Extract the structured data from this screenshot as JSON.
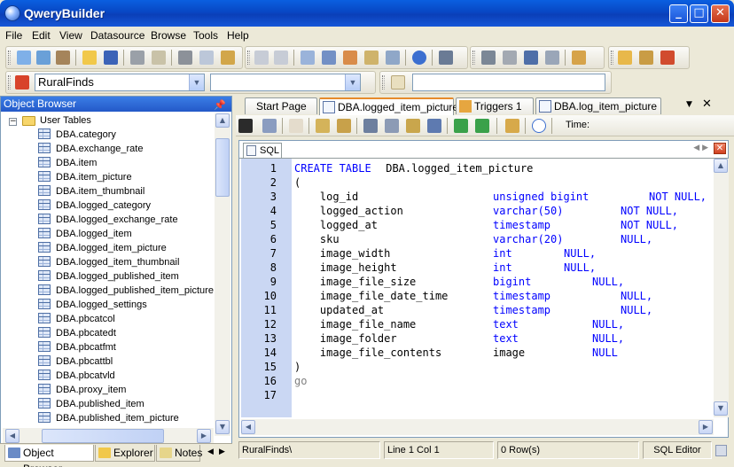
{
  "window": {
    "title": "QweryBuilder"
  },
  "menu": [
    "File",
    "Edit",
    "View",
    "Datasource",
    "Browse",
    "Tools",
    "Help"
  ],
  "connection": {
    "value": "RuralFinds",
    "second_value": "",
    "third_value": ""
  },
  "object_browser": {
    "title": "Object Browser",
    "root": "User Tables",
    "items": [
      "DBA.category",
      "DBA.exchange_rate",
      "DBA.item",
      "DBA.item_picture",
      "DBA.item_thumbnail",
      "DBA.logged_category",
      "DBA.logged_exchange_rate",
      "DBA.logged_item",
      "DBA.logged_item_picture",
      "DBA.logged_item_thumbnail",
      "DBA.logged_published_item",
      "DBA.logged_published_item_picture",
      "DBA.logged_settings",
      "DBA.pbcatcol",
      "DBA.pbcatedt",
      "DBA.pbcatfmt",
      "DBA.pbcattbl",
      "DBA.pbcatvld",
      "DBA.proxy_item",
      "DBA.published_item",
      "DBA.published_item_picture"
    ],
    "tabs": [
      "Object Browser",
      "Explorer",
      "Notes"
    ]
  },
  "doc_tabs": [
    "Start Page",
    "DBA.logged_item_picture",
    "Triggers 1",
    "DBA.log_item_picture"
  ],
  "edit_toolbar": {
    "time_label": "Time:"
  },
  "sql_tab": "SQL",
  "code": [
    [
      {
        "t": "CREATE TABLE",
        "c": "kw"
      },
      {
        "t": " DBA.logged_item_picture",
        "c": ""
      }
    ],
    [
      {
        "t": "(",
        "c": ""
      }
    ],
    [
      {
        "t": "    log_id",
        "c": ""
      },
      {
        "t": "unsigned bigint",
        "c": "ty",
        "col": 28
      },
      {
        "t": "NOT NULL,",
        "c": "kw",
        "col": 50
      }
    ],
    [
      {
        "t": "    logged_action",
        "c": ""
      },
      {
        "t": "varchar(50)",
        "c": "ty",
        "col": 28
      },
      {
        "t": "NOT NULL,",
        "c": "kw",
        "col": 46
      }
    ],
    [
      {
        "t": "    logged_at",
        "c": ""
      },
      {
        "t": "timestamp",
        "c": "ty",
        "col": 28
      },
      {
        "t": "NOT NULL,",
        "c": "kw",
        "col": 46
      }
    ],
    [
      {
        "t": "    sku",
        "c": ""
      },
      {
        "t": "varchar(20)",
        "c": "ty",
        "col": 28
      },
      {
        "t": "NULL,",
        "c": "kw",
        "col": 46
      }
    ],
    [
      {
        "t": "    image_width",
        "c": ""
      },
      {
        "t": "int",
        "c": "ty",
        "col": 28
      },
      {
        "t": "NULL,",
        "c": "kw",
        "col": 38
      }
    ],
    [
      {
        "t": "    image_height",
        "c": ""
      },
      {
        "t": "int",
        "c": "ty",
        "col": 28
      },
      {
        "t": "NULL,",
        "c": "kw",
        "col": 38
      }
    ],
    [
      {
        "t": "    image_file_size",
        "c": ""
      },
      {
        "t": "bigint",
        "c": "ty",
        "col": 28
      },
      {
        "t": "NULL,",
        "c": "kw",
        "col": 42
      }
    ],
    [
      {
        "t": "    image_file_date_time",
        "c": ""
      },
      {
        "t": "timestamp",
        "c": "ty",
        "col": 28
      },
      {
        "t": "NULL,",
        "c": "kw",
        "col": 46
      }
    ],
    [
      {
        "t": "    updated_at",
        "c": ""
      },
      {
        "t": "timestamp",
        "c": "ty",
        "col": 28
      },
      {
        "t": "NULL,",
        "c": "kw",
        "col": 46
      }
    ],
    [
      {
        "t": "    image_file_name",
        "c": ""
      },
      {
        "t": "text",
        "c": "ty",
        "col": 28
      },
      {
        "t": "NULL,",
        "c": "kw",
        "col": 42
      }
    ],
    [
      {
        "t": "    image_folder",
        "c": ""
      },
      {
        "t": "text",
        "c": "ty",
        "col": 28
      },
      {
        "t": "NULL,",
        "c": "kw",
        "col": 42
      }
    ],
    [
      {
        "t": "    image_file_contents",
        "c": ""
      },
      {
        "t": "image",
        "c": "",
        "col": 28
      },
      {
        "t": "NULL",
        "c": "kw",
        "col": 42
      }
    ],
    [
      {
        "t": ")",
        "c": ""
      }
    ],
    [
      {
        "t": "go",
        "c": "gr"
      }
    ],
    []
  ],
  "status": {
    "path": "RuralFinds\\",
    "position": "Line 1 Col 1",
    "rows": "0 Row(s)",
    "mode": "SQL Editor"
  }
}
